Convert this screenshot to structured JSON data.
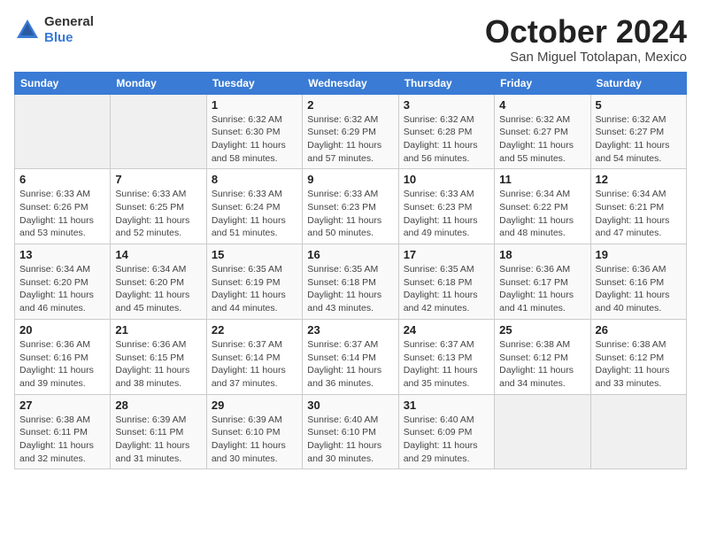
{
  "header": {
    "logo_general": "General",
    "logo_blue": "Blue",
    "month_title": "October 2024",
    "location": "San Miguel Totolapan, Mexico"
  },
  "days_of_week": [
    "Sunday",
    "Monday",
    "Tuesday",
    "Wednesday",
    "Thursday",
    "Friday",
    "Saturday"
  ],
  "weeks": [
    [
      {
        "day": "",
        "info": ""
      },
      {
        "day": "",
        "info": ""
      },
      {
        "day": "1",
        "info": "Sunrise: 6:32 AM\nSunset: 6:30 PM\nDaylight: 11 hours and 58 minutes."
      },
      {
        "day": "2",
        "info": "Sunrise: 6:32 AM\nSunset: 6:29 PM\nDaylight: 11 hours and 57 minutes."
      },
      {
        "day": "3",
        "info": "Sunrise: 6:32 AM\nSunset: 6:28 PM\nDaylight: 11 hours and 56 minutes."
      },
      {
        "day": "4",
        "info": "Sunrise: 6:32 AM\nSunset: 6:27 PM\nDaylight: 11 hours and 55 minutes."
      },
      {
        "day": "5",
        "info": "Sunrise: 6:32 AM\nSunset: 6:27 PM\nDaylight: 11 hours and 54 minutes."
      }
    ],
    [
      {
        "day": "6",
        "info": "Sunrise: 6:33 AM\nSunset: 6:26 PM\nDaylight: 11 hours and 53 minutes."
      },
      {
        "day": "7",
        "info": "Sunrise: 6:33 AM\nSunset: 6:25 PM\nDaylight: 11 hours and 52 minutes."
      },
      {
        "day": "8",
        "info": "Sunrise: 6:33 AM\nSunset: 6:24 PM\nDaylight: 11 hours and 51 minutes."
      },
      {
        "day": "9",
        "info": "Sunrise: 6:33 AM\nSunset: 6:23 PM\nDaylight: 11 hours and 50 minutes."
      },
      {
        "day": "10",
        "info": "Sunrise: 6:33 AM\nSunset: 6:23 PM\nDaylight: 11 hours and 49 minutes."
      },
      {
        "day": "11",
        "info": "Sunrise: 6:34 AM\nSunset: 6:22 PM\nDaylight: 11 hours and 48 minutes."
      },
      {
        "day": "12",
        "info": "Sunrise: 6:34 AM\nSunset: 6:21 PM\nDaylight: 11 hours and 47 minutes."
      }
    ],
    [
      {
        "day": "13",
        "info": "Sunrise: 6:34 AM\nSunset: 6:20 PM\nDaylight: 11 hours and 46 minutes."
      },
      {
        "day": "14",
        "info": "Sunrise: 6:34 AM\nSunset: 6:20 PM\nDaylight: 11 hours and 45 minutes."
      },
      {
        "day": "15",
        "info": "Sunrise: 6:35 AM\nSunset: 6:19 PM\nDaylight: 11 hours and 44 minutes."
      },
      {
        "day": "16",
        "info": "Sunrise: 6:35 AM\nSunset: 6:18 PM\nDaylight: 11 hours and 43 minutes."
      },
      {
        "day": "17",
        "info": "Sunrise: 6:35 AM\nSunset: 6:18 PM\nDaylight: 11 hours and 42 minutes."
      },
      {
        "day": "18",
        "info": "Sunrise: 6:36 AM\nSunset: 6:17 PM\nDaylight: 11 hours and 41 minutes."
      },
      {
        "day": "19",
        "info": "Sunrise: 6:36 AM\nSunset: 6:16 PM\nDaylight: 11 hours and 40 minutes."
      }
    ],
    [
      {
        "day": "20",
        "info": "Sunrise: 6:36 AM\nSunset: 6:16 PM\nDaylight: 11 hours and 39 minutes."
      },
      {
        "day": "21",
        "info": "Sunrise: 6:36 AM\nSunset: 6:15 PM\nDaylight: 11 hours and 38 minutes."
      },
      {
        "day": "22",
        "info": "Sunrise: 6:37 AM\nSunset: 6:14 PM\nDaylight: 11 hours and 37 minutes."
      },
      {
        "day": "23",
        "info": "Sunrise: 6:37 AM\nSunset: 6:14 PM\nDaylight: 11 hours and 36 minutes."
      },
      {
        "day": "24",
        "info": "Sunrise: 6:37 AM\nSunset: 6:13 PM\nDaylight: 11 hours and 35 minutes."
      },
      {
        "day": "25",
        "info": "Sunrise: 6:38 AM\nSunset: 6:12 PM\nDaylight: 11 hours and 34 minutes."
      },
      {
        "day": "26",
        "info": "Sunrise: 6:38 AM\nSunset: 6:12 PM\nDaylight: 11 hours and 33 minutes."
      }
    ],
    [
      {
        "day": "27",
        "info": "Sunrise: 6:38 AM\nSunset: 6:11 PM\nDaylight: 11 hours and 32 minutes."
      },
      {
        "day": "28",
        "info": "Sunrise: 6:39 AM\nSunset: 6:11 PM\nDaylight: 11 hours and 31 minutes."
      },
      {
        "day": "29",
        "info": "Sunrise: 6:39 AM\nSunset: 6:10 PM\nDaylight: 11 hours and 30 minutes."
      },
      {
        "day": "30",
        "info": "Sunrise: 6:40 AM\nSunset: 6:10 PM\nDaylight: 11 hours and 30 minutes."
      },
      {
        "day": "31",
        "info": "Sunrise: 6:40 AM\nSunset: 6:09 PM\nDaylight: 11 hours and 29 minutes."
      },
      {
        "day": "",
        "info": ""
      },
      {
        "day": "",
        "info": ""
      }
    ]
  ]
}
